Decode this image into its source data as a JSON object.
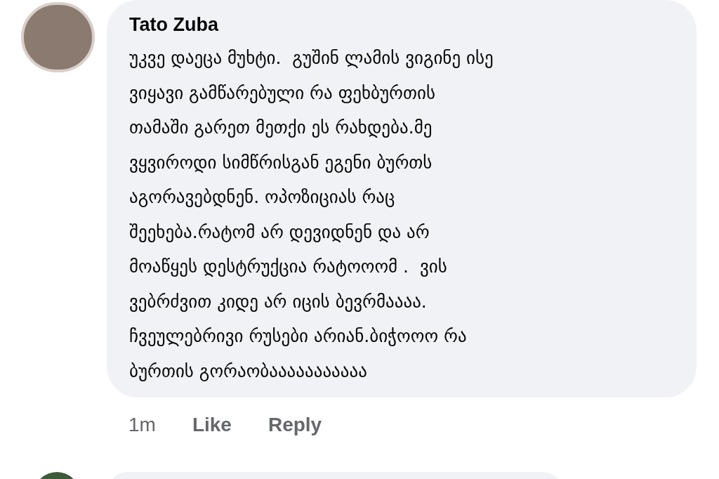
{
  "comment": {
    "author": "Tato Zuba",
    "lines": [
      "უკვე დაეცა მუხტი.  გუშინ ლამის ვიგინე ისე",
      "ვიყავი გამწარებული რა ფეხბურთის",
      "თამაში გარეთ მეთქი ეს რახდება.მე",
      "ვყვიროდი სიმწრისგან ეგენი ბურთს",
      "აგორავებდნენ. ოპოზიციას რაც",
      "შეეხება.რატომ არ დევიდნენ და არ",
      "მოაწყეს დესტრუქცია რატოოომ .  ვის",
      "ვებრძვით კიდე არ იცის ბევრმაააა.",
      "ჩვეულებრივი რუსები არიან.ბიჭოოო რა",
      "ბურთის გორაობააააააააააა"
    ],
    "time": "1m",
    "actions": [
      "Like",
      "Reply"
    ]
  }
}
